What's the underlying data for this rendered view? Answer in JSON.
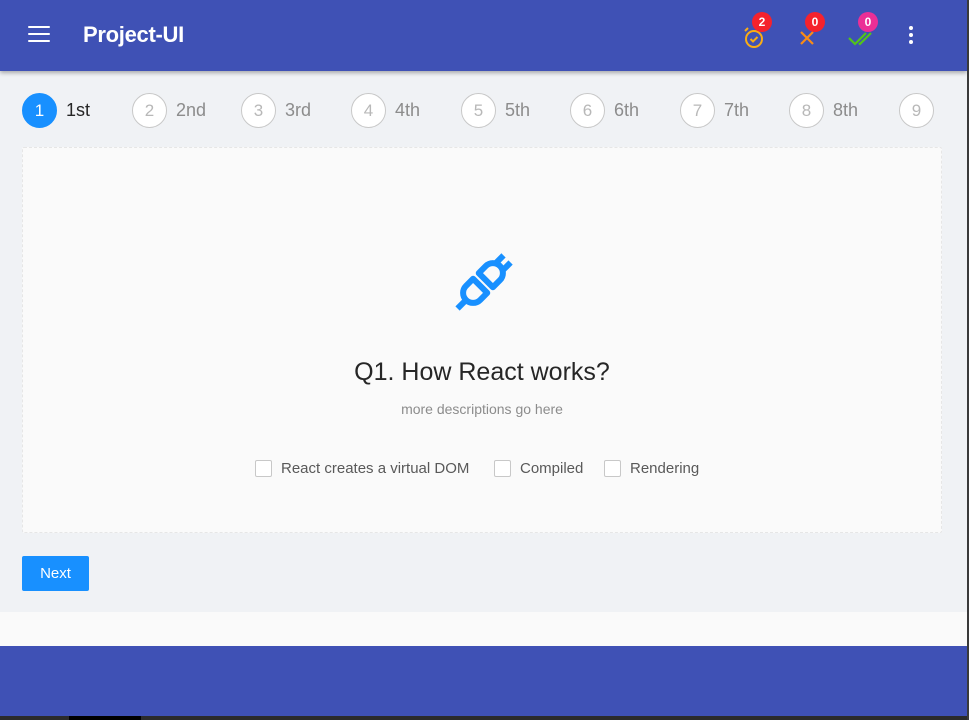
{
  "app": {
    "title": "Project-UI"
  },
  "header": {
    "alarm": {
      "icon": "alarm-check-icon",
      "count": "2",
      "badge_color": "#f5222d",
      "icon_color": "#faad14"
    },
    "wrong": {
      "icon": "close-icon",
      "count": "0",
      "badge_color": "#f5222d",
      "icon_color": "#fa8c16"
    },
    "correct": {
      "icon": "double-check-icon",
      "count": "0",
      "badge_color": "#eb2f96",
      "icon_color": "#52c41a"
    },
    "more": {
      "icon": "more-vertical-icon"
    }
  },
  "steps": [
    {
      "num": "1",
      "label": "1st",
      "active": true
    },
    {
      "num": "2",
      "label": "2nd"
    },
    {
      "num": "3",
      "label": "3rd"
    },
    {
      "num": "4",
      "label": "4th"
    },
    {
      "num": "5",
      "label": "5th"
    },
    {
      "num": "6",
      "label": "6th"
    },
    {
      "num": "7",
      "label": "7th"
    },
    {
      "num": "8",
      "label": "8th"
    },
    {
      "num": "9",
      "label": ""
    }
  ],
  "question": {
    "icon": "plug-icon",
    "title": "Q1. How React works?",
    "description": "more descriptions go here",
    "options": [
      {
        "label": "React creates a virtual DOM",
        "checked": false
      },
      {
        "label": "Compiled",
        "checked": false
      },
      {
        "label": "Rendering",
        "checked": false
      }
    ]
  },
  "actions": {
    "next_label": "Next"
  },
  "colors": {
    "primary": "#3f51b5",
    "accent": "#1890ff",
    "background": "#f0f2f5"
  }
}
